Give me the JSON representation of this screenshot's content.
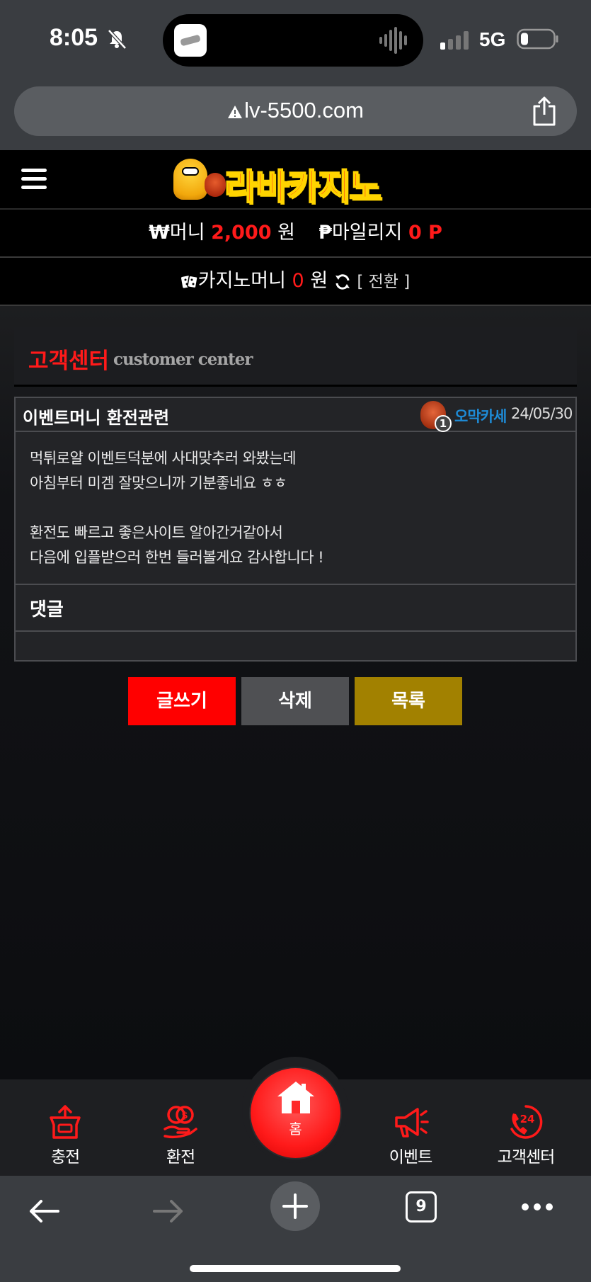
{
  "status_bar": {
    "time": "8:05",
    "network": "5G"
  },
  "browser": {
    "url": "lv-5500.com",
    "tab_count": "9"
  },
  "site": {
    "logo_text": "라바카지노",
    "money": {
      "won_symbol": "₩",
      "money_label": "머니",
      "money_value": "2,000",
      "money_unit": "원",
      "mileage_symbol": "₱",
      "mileage_label": "마일리지",
      "mileage_value": "0 P"
    },
    "casino": {
      "label": "카지노머니",
      "value": "0",
      "unit": "원",
      "convert": "[ 전환 ]"
    }
  },
  "section": {
    "title_ko": "고객센터",
    "title_en": "customer center"
  },
  "post": {
    "title": "이벤트머니 환전관련",
    "author_level": "1",
    "author": "오막카세",
    "date": "24/05/30",
    "body_lines": [
      "먹튀로얄 이벤트덕분에 사대맞추러 와봤는데",
      "아침부터 미겜 잘맞으니까 기분좋네요 ㅎㅎ",
      "",
      "환전도 빠르고 좋은사이트 알아간거같아서",
      "다음에 입플받으러 한번 들러볼게요 감사합니다 !"
    ],
    "comments_label": "댓글"
  },
  "buttons": {
    "write": "글쓰기",
    "delete": "삭제",
    "list": "목록"
  },
  "bottom_nav": {
    "charge": "충전",
    "exchange": "환전",
    "home": "홈",
    "event": "이벤트",
    "support": "고객센터"
  },
  "colors": {
    "accent_red": "#ff0000",
    "author_blue": "#1e8bd6",
    "list_gold": "#a28100",
    "delete_gray": "#4f5053"
  }
}
